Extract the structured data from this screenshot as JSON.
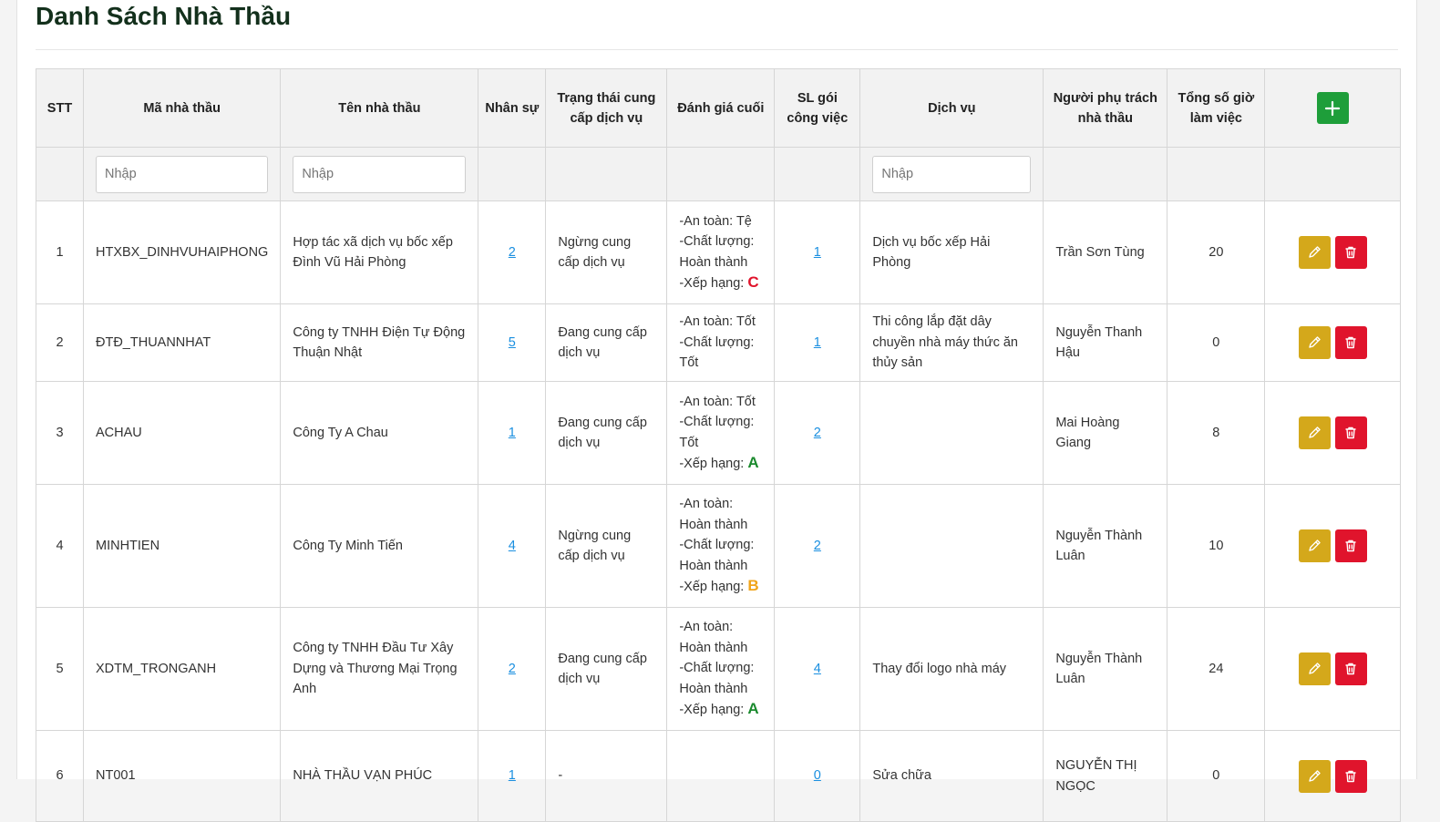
{
  "page": {
    "title": "Danh Sách Nhà Thầu"
  },
  "colors": {
    "add": "#1e9e3a",
    "edit": "#d4a81b",
    "delete": "#e0142c",
    "link": "#1a8fe0",
    "grade_A": "#1b8a2e",
    "grade_B": "#f0a419",
    "grade_C": "#e0142c"
  },
  "table": {
    "headers": {
      "stt": "STT",
      "code": "Mã nhà thầu",
      "name": "Tên nhà thầu",
      "staff": "Nhân sự",
      "status": "Trạng thái cung cấp dịch vụ",
      "evaluation": "Đánh giá cuối",
      "packages": "SL gói công việc",
      "service": "Dịch vụ",
      "manager": "Người phụ trách nhà thầu",
      "hours": "Tổng số giờ làm việc"
    },
    "add_icon": "plus-icon",
    "filter_placeholder": "Nhập",
    "rows": [
      {
        "stt": "1",
        "code": "HTXBX_DINHVUHAIPHONG",
        "name": "Hợp tác xã dịch vụ bốc xếp Đình Vũ Hải Phòng",
        "staff": "2",
        "status": "Ngừng cung cấp dịch vụ",
        "eval_lines": [
          "-An toàn: Tệ",
          "-Chất lượng: Hoàn thành"
        ],
        "grade_label": "-Xếp hạng: ",
        "grade": "C",
        "packages": "1",
        "service": "Dịch vụ bốc xếp Hải Phòng",
        "manager": "Trần Sơn Tùng",
        "hours": "20"
      },
      {
        "stt": "2",
        "code": "ĐTĐ_THUANNHAT",
        "name": "Công ty TNHH Điện Tự Động Thuận Nhật",
        "staff": "5",
        "status": "Đang cung cấp dịch vụ",
        "eval_lines": [
          "-An toàn: Tốt",
          "-Chất lượng: Tốt"
        ],
        "grade_label": "",
        "grade": "",
        "packages": "1",
        "service": "Thi công lắp đặt dây chuyền nhà máy thức ăn thủy sản",
        "manager": "Nguyễn Thanh Hậu",
        "hours": "0"
      },
      {
        "stt": "3",
        "code": "ACHAU",
        "name": "Công Ty A Chau",
        "staff": "1",
        "status": "Đang cung cấp dịch vụ",
        "eval_lines": [
          "-An toàn: Tốt",
          "-Chất lượng: Tốt"
        ],
        "grade_label": "-Xếp hạng: ",
        "grade": "A",
        "packages": "2",
        "service": "",
        "manager": "Mai Hoàng Giang",
        "hours": "8"
      },
      {
        "stt": "4",
        "code": "MINHTIEN",
        "name": "Công Ty Minh Tiến",
        "staff": "4",
        "status": "Ngừng cung cấp dịch vụ",
        "eval_lines": [
          "-An toàn: Hoàn thành",
          "-Chất lượng: Hoàn thành"
        ],
        "grade_label": "-Xếp hạng: ",
        "grade": "B",
        "packages": "2",
        "service": "",
        "manager": "Nguyễn Thành Luân",
        "hours": "10"
      },
      {
        "stt": "5",
        "code": "XDTM_TRONGANH",
        "name": "Công ty TNHH Đầu Tư Xây Dựng và Thương Mại Trọng Anh",
        "staff": "2",
        "status": "Đang cung cấp dịch vụ",
        "eval_lines": [
          "-An toàn: Hoàn thành",
          "-Chất lượng: Hoàn thành"
        ],
        "grade_label": "-Xếp hạng: ",
        "grade": "A",
        "packages": "4",
        "service": "Thay đổi logo nhà máy",
        "manager": "Nguyễn Thành Luân",
        "hours": "24"
      },
      {
        "stt": "6",
        "code": "NT001",
        "name": "NHÀ THẦU VẠN PHÚC",
        "staff": "1",
        "status": "-",
        "eval_lines": [],
        "grade_label": "",
        "grade": "",
        "packages": "0",
        "service": "Sửa chữa",
        "manager": "NGUYỄN THỊ NGỌC",
        "hours": "0"
      }
    ]
  }
}
